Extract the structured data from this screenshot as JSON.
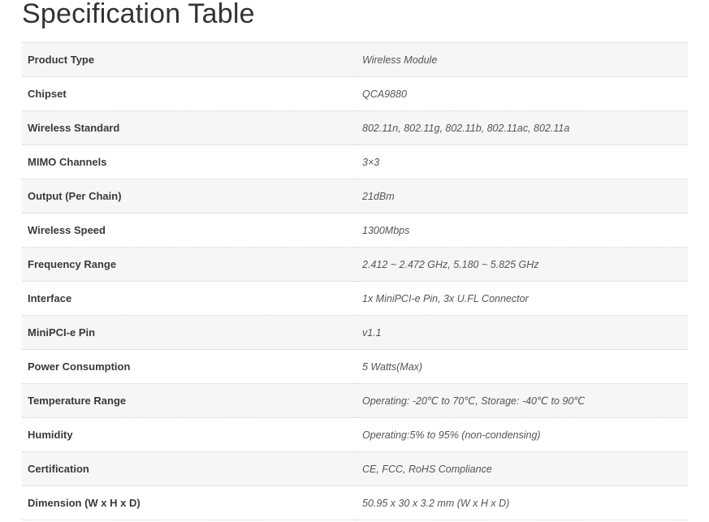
{
  "page": {
    "title": "Specification Table"
  },
  "specs": [
    {
      "label": "Product Type",
      "value": "Wireless Module"
    },
    {
      "label": "Chipset",
      "value": "QCA9880"
    },
    {
      "label": "Wireless Standard",
      "value": "802.11n, 802.11g, 802.11b, 802.11ac, 802.11a"
    },
    {
      "label": "MIMO Channels",
      "value": "3×3"
    },
    {
      "label": "Output (Per Chain)",
      "value": "21dBm"
    },
    {
      "label": "Wireless Speed",
      "value": "1300Mbps"
    },
    {
      "label": "Frequency Range",
      "value": "2.412 ~ 2.472 GHz, 5.180 ~ 5.825 GHz"
    },
    {
      "label": "Interface",
      "value": "1x MiniPCI-e Pin, 3x U.FL Connector"
    },
    {
      "label": "MiniPCI-e Pin",
      "value": "v1.1"
    },
    {
      "label": "Power Consumption",
      "value": "5 Watts(Max)"
    },
    {
      "label": "Temperature Range",
      "value": "Operating: -20℃ to 70℃, Storage: -40℃ to 90℃"
    },
    {
      "label": "Humidity",
      "value": "Operating:5% to 95% (non-condensing)"
    },
    {
      "label": "Certification",
      "value": "CE, FCC, RoHS Compliance"
    },
    {
      "label": "Dimension (W x H x D)",
      "value": "50.95 x 30 x 3.2 mm (W x H x D)"
    }
  ]
}
